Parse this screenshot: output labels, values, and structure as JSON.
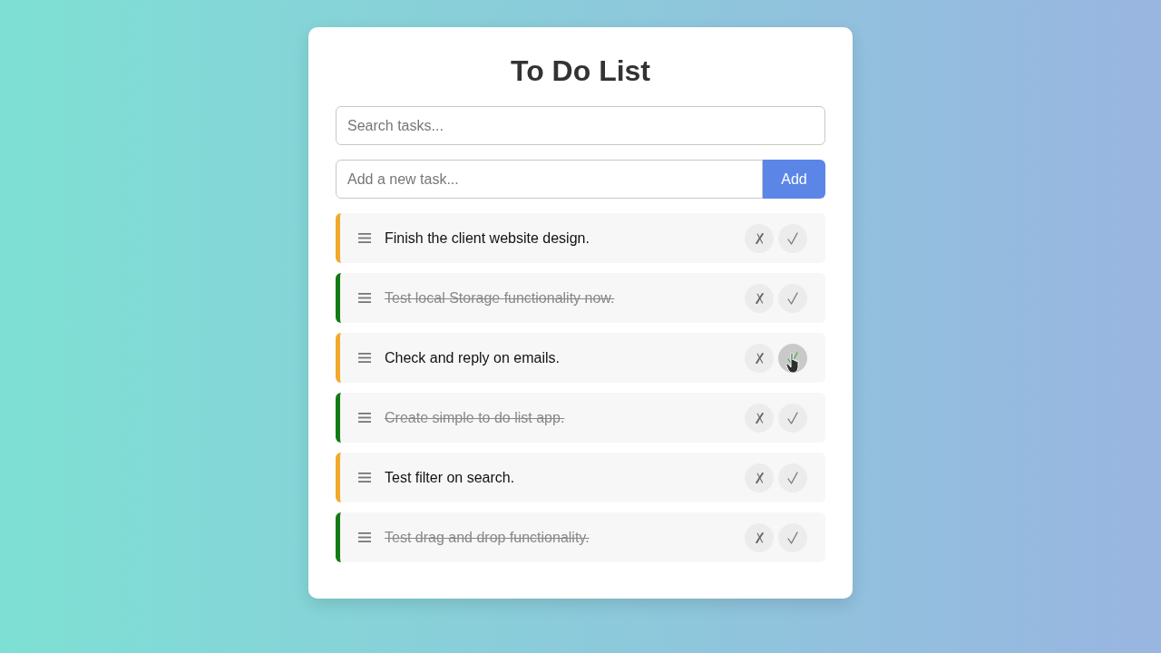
{
  "app": {
    "title": "To Do List"
  },
  "search": {
    "placeholder": "Search tasks..."
  },
  "new_task": {
    "placeholder": "Add a new task...",
    "button": "Add"
  },
  "tasks": [
    {
      "text": "Finish the client website design.",
      "done": false,
      "check_hovered": false
    },
    {
      "text": "Test local Storage functionality now.",
      "done": true,
      "check_hovered": false
    },
    {
      "text": "Check and reply on emails.",
      "done": false,
      "check_hovered": true
    },
    {
      "text": "Create simple to do list app.",
      "done": true,
      "check_hovered": false
    },
    {
      "text": "Test filter on search.",
      "done": false,
      "check_hovered": false
    },
    {
      "text": "Test drag and drop functionality.",
      "done": true,
      "check_hovered": false
    }
  ]
}
